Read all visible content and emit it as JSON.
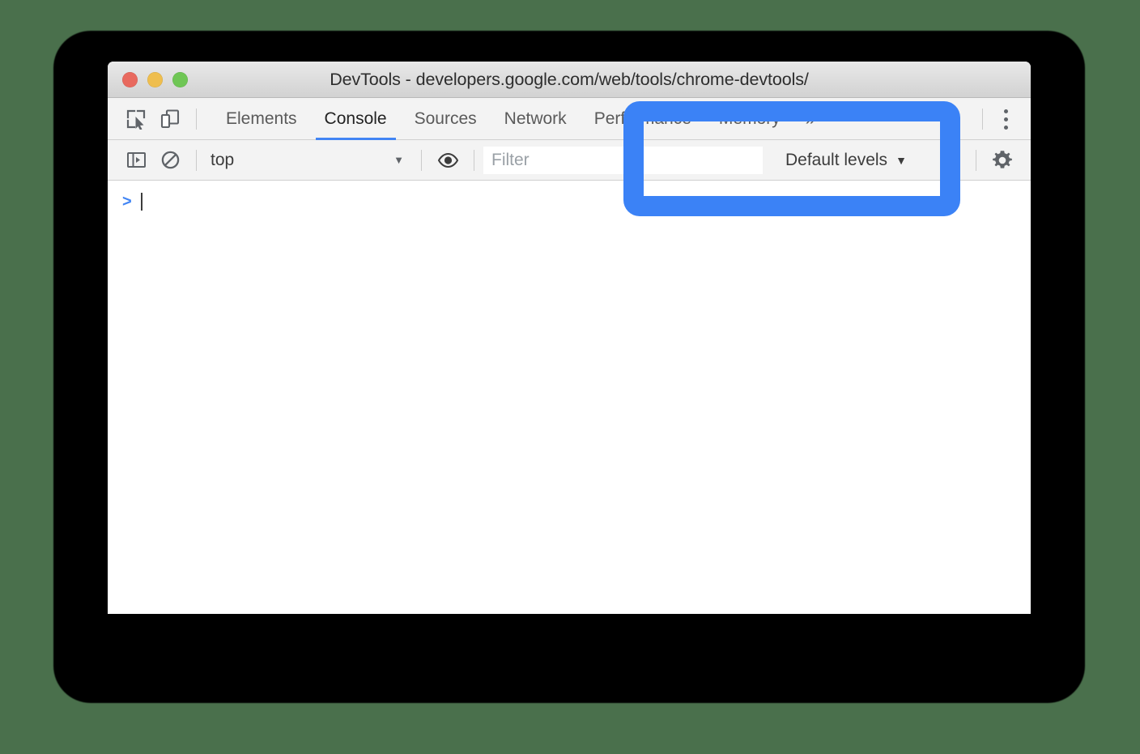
{
  "window": {
    "title": "DevTools - developers.google.com/web/tools/chrome-devtools/",
    "traffic_lights": [
      {
        "name": "close",
        "color": "#e8695e"
      },
      {
        "name": "minimize",
        "color": "#efbe4e"
      },
      {
        "name": "zoom",
        "color": "#6fc655"
      }
    ]
  },
  "tab_bar": {
    "inspect_icon": "inspect-element-icon",
    "device_icon": "device-toolbar-icon",
    "tabs": [
      {
        "label": "Elements",
        "active": false
      },
      {
        "label": "Console",
        "active": true
      },
      {
        "label": "Sources",
        "active": false
      },
      {
        "label": "Network",
        "active": false
      },
      {
        "label": "Performance",
        "active": false
      },
      {
        "label": "Memory",
        "active": false
      }
    ],
    "overflow_label": "»",
    "more_menu_icon": "kebab-menu-icon"
  },
  "filter_bar": {
    "sidebar_toggle_icon": "console-sidebar-icon",
    "clear_console_icon": "clear-console-icon",
    "context": {
      "value": "top",
      "caret": "▼"
    },
    "live_expression_icon": "eye-icon",
    "filter": {
      "value": "",
      "placeholder": "Filter"
    },
    "levels": {
      "value": "Default levels",
      "caret": "▼"
    },
    "settings_icon": "gear-icon"
  },
  "console": {
    "prompt_symbol": ">",
    "input_value": ""
  },
  "annotation": {
    "name": "highlight-box",
    "color": "#3b82f6",
    "target": "Default levels"
  },
  "colors": {
    "background": "#4a704c",
    "accent_blue": "#4285f4",
    "highlight_blue": "#3b82f6",
    "toolbar_bg": "#f3f3f3",
    "titlebar_bg": "#dcdcdc"
  }
}
